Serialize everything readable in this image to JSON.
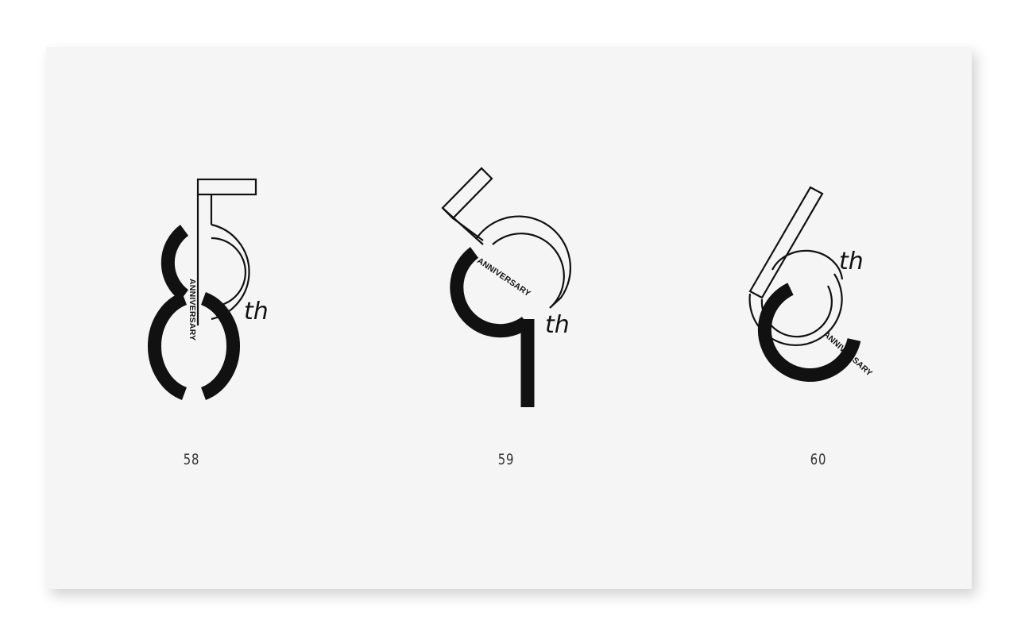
{
  "logos": [
    {
      "number": "58",
      "suffix": "th",
      "tagline": "ANNIVERSARY"
    },
    {
      "number": "59",
      "suffix": "th",
      "tagline": "ANNIVERSARY"
    },
    {
      "number": "60",
      "suffix": "th",
      "tagline": "ANNIVERSARY"
    }
  ],
  "colors": {
    "background": "#ffffff",
    "card": "#f5f5f5",
    "ink": "#111111"
  }
}
